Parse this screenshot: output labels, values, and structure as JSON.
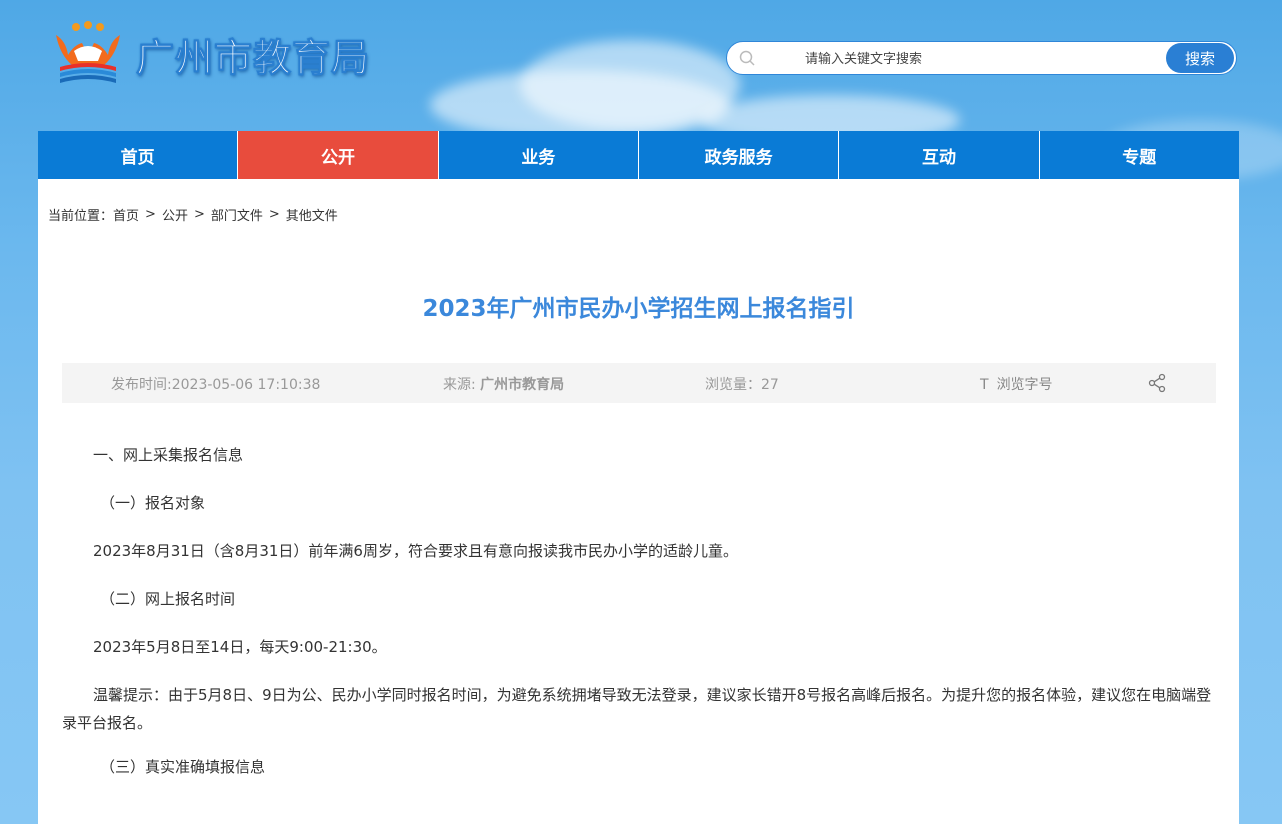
{
  "header": {
    "site_title": "广州市教育局",
    "search": {
      "placeholder": "请输入关键文字搜索",
      "button_label": "搜索"
    }
  },
  "nav": {
    "items": [
      {
        "label": "首页",
        "active": false
      },
      {
        "label": "公开",
        "active": true
      },
      {
        "label": "业务",
        "active": false
      },
      {
        "label": "政务服务",
        "active": false
      },
      {
        "label": "互动",
        "active": false
      },
      {
        "label": "专题",
        "active": false
      }
    ]
  },
  "breadcrumb": {
    "prefix": "当前位置：",
    "items": [
      "首页",
      "公开",
      "部门文件",
      "其他文件"
    ],
    "separator": ">"
  },
  "article": {
    "title": "2023年广州市民办小学招生网上报名指引",
    "meta": {
      "publish_time": "发布时间:2023-05-06 17:10:38",
      "source_label": "来源: ",
      "source_value": "广州市教育局",
      "views": "浏览量：27",
      "font_size_icon": "T",
      "font_size_label": "浏览字号"
    },
    "paragraphs": [
      "一、网上采集报名信息",
      "（一）报名对象",
      "2023年8月31日（含8月31日）前年满6周岁，符合要求且有意向报读我市民办小学的适龄儿童。",
      "（二）网上报名时间",
      "2023年5月8日至14日，每天9:00-21:30。",
      "温馨提示：由于5月8日、9日为公、民办小学同时报名时间，为避免系统拥堵导致无法登录，建议家长错开8号报名高峰后报名。为提升您的报名体验，建议您在电脑端登录平台报名。",
      "（三）真实准确填报信息"
    ]
  },
  "colors": {
    "nav_bg": "#0a7bd6",
    "nav_active": "#e84c3d",
    "title_blue": "#3b88db",
    "search_button": "#2a7fd4"
  }
}
